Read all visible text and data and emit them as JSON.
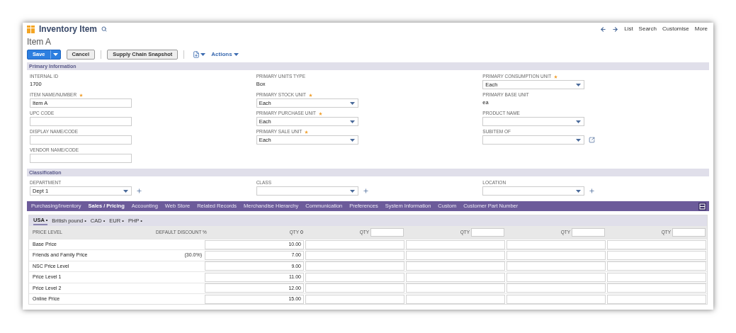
{
  "header": {
    "title": "Inventory Item",
    "nav_links": [
      "List",
      "Search",
      "Customise",
      "More"
    ]
  },
  "record_name": "Item A",
  "toolbar": {
    "buttons": [
      {
        "label": "Save",
        "kind": "primary"
      },
      {
        "label": "Cancel",
        "kind": "plain"
      },
      {
        "label": "Supply Chain Snapshot",
        "kind": "plain"
      }
    ],
    "actions": "Actions"
  },
  "sections": [
    {
      "title": "Primary Information",
      "columns": [
        [
          {
            "kind": "display",
            "label": "INTERNAL ID",
            "value": "1700"
          },
          {
            "kind": "input",
            "label": "ITEM NAME/NUMBER",
            "required": true,
            "value": "Item A"
          },
          {
            "kind": "input",
            "label": "UPC CODE",
            "required": false
          },
          {
            "kind": "input",
            "label": "DISPLAY NAME/CODE",
            "required": false
          },
          {
            "kind": "input",
            "label": "VENDOR NAME/CODE",
            "required": false
          }
        ],
        [
          {
            "kind": "display",
            "label": "PRIMARY UNITS TYPE",
            "value": "Box"
          },
          {
            "kind": "select",
            "label": "PRIMARY STOCK UNIT",
            "required": true,
            "value": "Each"
          },
          {
            "kind": "select",
            "label": "PRIMARY PURCHASE UNIT",
            "required": true,
            "value": "Each"
          },
          {
            "kind": "select",
            "label": "PRIMARY SALE UNIT",
            "required": true,
            "value": "Each"
          }
        ],
        [
          {
            "kind": "select",
            "label": "PRIMARY CONSUMPTION UNIT",
            "required": true,
            "value": "Each"
          },
          {
            "kind": "display",
            "label": "PRIMARY BASE UNIT",
            "value": "ea"
          },
          {
            "kind": "select",
            "label": "PRODUCT NAME",
            "required": false
          },
          {
            "kind": "select",
            "label": "SUBITEM OF",
            "required": false,
            "open_link": true
          }
        ]
      ]
    },
    {
      "title": "Classification",
      "columns": [
        [
          {
            "kind": "select",
            "label": "DEPARTMENT",
            "required": false,
            "value": "Dept 1",
            "add": true
          }
        ],
        [
          {
            "kind": "select",
            "label": "CLASS",
            "required": false,
            "add": true
          }
        ],
        [
          {
            "kind": "select",
            "label": "LOCATION",
            "required": false,
            "add": true
          }
        ]
      ]
    }
  ],
  "subtabs": [
    {
      "label": "Purchasing/Inventory",
      "selected": false
    },
    {
      "label": "Sales / Pricing",
      "selected": true
    },
    {
      "label": "Accounting",
      "selected": false
    },
    {
      "label": "Web Store",
      "selected": false
    },
    {
      "label": "Related Records",
      "selected": false
    },
    {
      "label": "Merchandise Hierarchy",
      "selected": false
    },
    {
      "label": "Communication",
      "selected": false
    },
    {
      "label": "Preferences",
      "selected": false
    },
    {
      "label": "System Information",
      "selected": false
    },
    {
      "label": "Custom",
      "selected": false
    },
    {
      "label": "Customer Part Number",
      "selected": false
    }
  ],
  "currencies": [
    {
      "label": "USA •",
      "selected": true
    },
    {
      "label": "British pound •",
      "selected": false
    },
    {
      "label": "CAD •",
      "selected": false
    },
    {
      "label": "EUR •",
      "selected": false
    },
    {
      "label": "PHP •",
      "selected": false
    }
  ],
  "price_table": {
    "columns": [
      "PRICE LEVEL",
      "DEFAULT DISCOUNT %"
    ],
    "qty_columns": [
      {
        "kind": "fixed",
        "label": "QTY",
        "value": "0"
      },
      {
        "kind": "input",
        "label": "QTY"
      },
      {
        "kind": "input",
        "label": "QTY"
      },
      {
        "kind": "input",
        "label": "QTY"
      },
      {
        "kind": "input",
        "label": "QTY"
      }
    ],
    "rows": [
      {
        "name": "Base Price",
        "prices": [
          "10.00"
        ]
      },
      {
        "name": "Friends and Family Price",
        "discount": "(30.0%)",
        "prices": [
          "7.00"
        ]
      },
      {
        "name": "NSC Price Level",
        "prices": [
          "9.00"
        ]
      },
      {
        "name": "Price Level 1",
        "prices": [
          "11.00"
        ]
      },
      {
        "name": "Price Level 2",
        "prices": [
          "12.00"
        ]
      },
      {
        "name": "Online Price",
        "prices": [
          "15.00"
        ]
      }
    ]
  }
}
